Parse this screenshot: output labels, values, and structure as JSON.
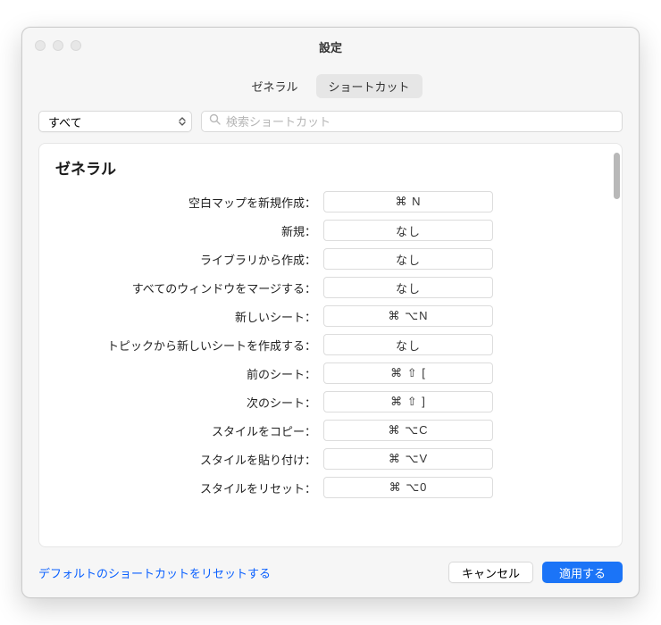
{
  "window": {
    "title": "設定"
  },
  "tabs": {
    "general": "ゼネラル",
    "shortcuts": "ショートカット"
  },
  "filter": {
    "selected": "すべて"
  },
  "search": {
    "placeholder": "検索ショートカット"
  },
  "section": {
    "title": "ゼネラル"
  },
  "rows": [
    {
      "label": "空白マップを新規作成：",
      "value": "⌘ N"
    },
    {
      "label": "新規：",
      "value": "なし"
    },
    {
      "label": "ライブラリから作成：",
      "value": "なし"
    },
    {
      "label": "すべてのウィンドウをマージする：",
      "value": "なし"
    },
    {
      "label": "新しいシート：",
      "value": "⌘ ⌥N"
    },
    {
      "label": "トピックから新しいシートを作成する：",
      "value": "なし"
    },
    {
      "label": "前のシート：",
      "value": "⌘ ⇧ ["
    },
    {
      "label": "次のシート：",
      "value": "⌘ ⇧ ]"
    },
    {
      "label": "スタイルをコピー：",
      "value": "⌘ ⌥C"
    },
    {
      "label": "スタイルを貼り付け：",
      "value": "⌘ ⌥V"
    },
    {
      "label": "スタイルをリセット：",
      "value": "⌘ ⌥0"
    }
  ],
  "footer": {
    "reset_link": "デフォルトのショートカットをリセットする",
    "cancel": "キャンセル",
    "apply": "適用する"
  }
}
